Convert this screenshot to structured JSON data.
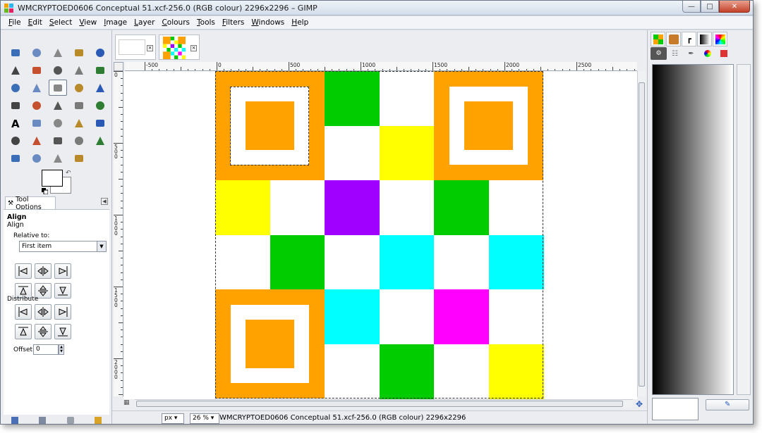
{
  "window": {
    "title": "WMCRYPTOED0606 Conceptual 51.xcf-256.0 (RGB colour) 2296x2296 – GIMP",
    "buttons": {
      "minimize": "—",
      "maximize": "□",
      "close": "✕"
    }
  },
  "menubar": [
    "File",
    "Edit",
    "Select",
    "View",
    "Image",
    "Layer",
    "Colours",
    "Tools",
    "Filters",
    "Windows",
    "Help"
  ],
  "toolbox": {
    "tools": [
      "rect-select-icon",
      "ellipse-select-icon",
      "free-select-icon",
      "fuzzy-select-icon",
      "select-by-color-icon",
      "scissors-icon",
      "foreground-select-icon",
      "paths-icon",
      "color-picker-icon",
      "zoom-icon",
      "measure-icon",
      "move-icon",
      "align-icon",
      "crop-icon",
      "rotate-icon",
      "scale-icon",
      "shear-icon",
      "perspective-icon",
      "flip-icon",
      "cage-icon",
      "text-icon",
      "bucket-fill-icon",
      "blend-icon",
      "pencil-icon",
      "paintbrush-icon",
      "eraser-icon",
      "airbrush-icon",
      "ink-icon",
      "clone-icon",
      "heal-icon",
      "perspective-clone-icon",
      "blur-icon",
      "smudge-icon",
      "dodge-burn-icon"
    ],
    "active_tool": "align-icon",
    "foreground_color": "#ffffff",
    "background_color": "#ffffff"
  },
  "tool_options": {
    "tab_label": "Tool Options",
    "title": "Align",
    "subtitle": "Align",
    "relative_to_label": "Relative to:",
    "relative_to_value": "First item",
    "distribute_label": "Distribute",
    "offset_label": "Offset:",
    "offset_value": "0"
  },
  "canvas": {
    "ruler_h_labels": [
      "-500",
      "0",
      "500",
      "1000",
      "1500",
      "2000",
      "2500"
    ],
    "ruler_v_labels": [
      "0",
      "500",
      "1000",
      "1500",
      "2000"
    ],
    "colors": {
      "orange": "#ffa200",
      "white": "#ffffff",
      "green": "#00cc00",
      "yellow": "#ffff00",
      "purple": "#a000ff",
      "cyan": "#00ffff",
      "magenta": "#ff00ff"
    },
    "grid": [
      [
        "corner",
        "corner",
        "green",
        "white",
        "corner",
        "corner"
      ],
      [
        "corner",
        "corner",
        "white",
        "yellow",
        "corner",
        "corner"
      ],
      [
        "yellow",
        "white",
        "purple",
        "white",
        "green",
        "white"
      ],
      [
        "white",
        "green",
        "white",
        "cyan",
        "white",
        "cyan"
      ],
      [
        "corner",
        "corner",
        "cyan",
        "white",
        "magenta",
        "white"
      ],
      [
        "corner",
        "corner",
        "white",
        "green",
        "white",
        "yellow"
      ]
    ]
  },
  "statusbar": {
    "unit": "px",
    "zoom": "26 %",
    "text": "WMCRYPTOED0606 Conceptual 51.xcf-256.0 (RGB colour) 2296x2296"
  }
}
